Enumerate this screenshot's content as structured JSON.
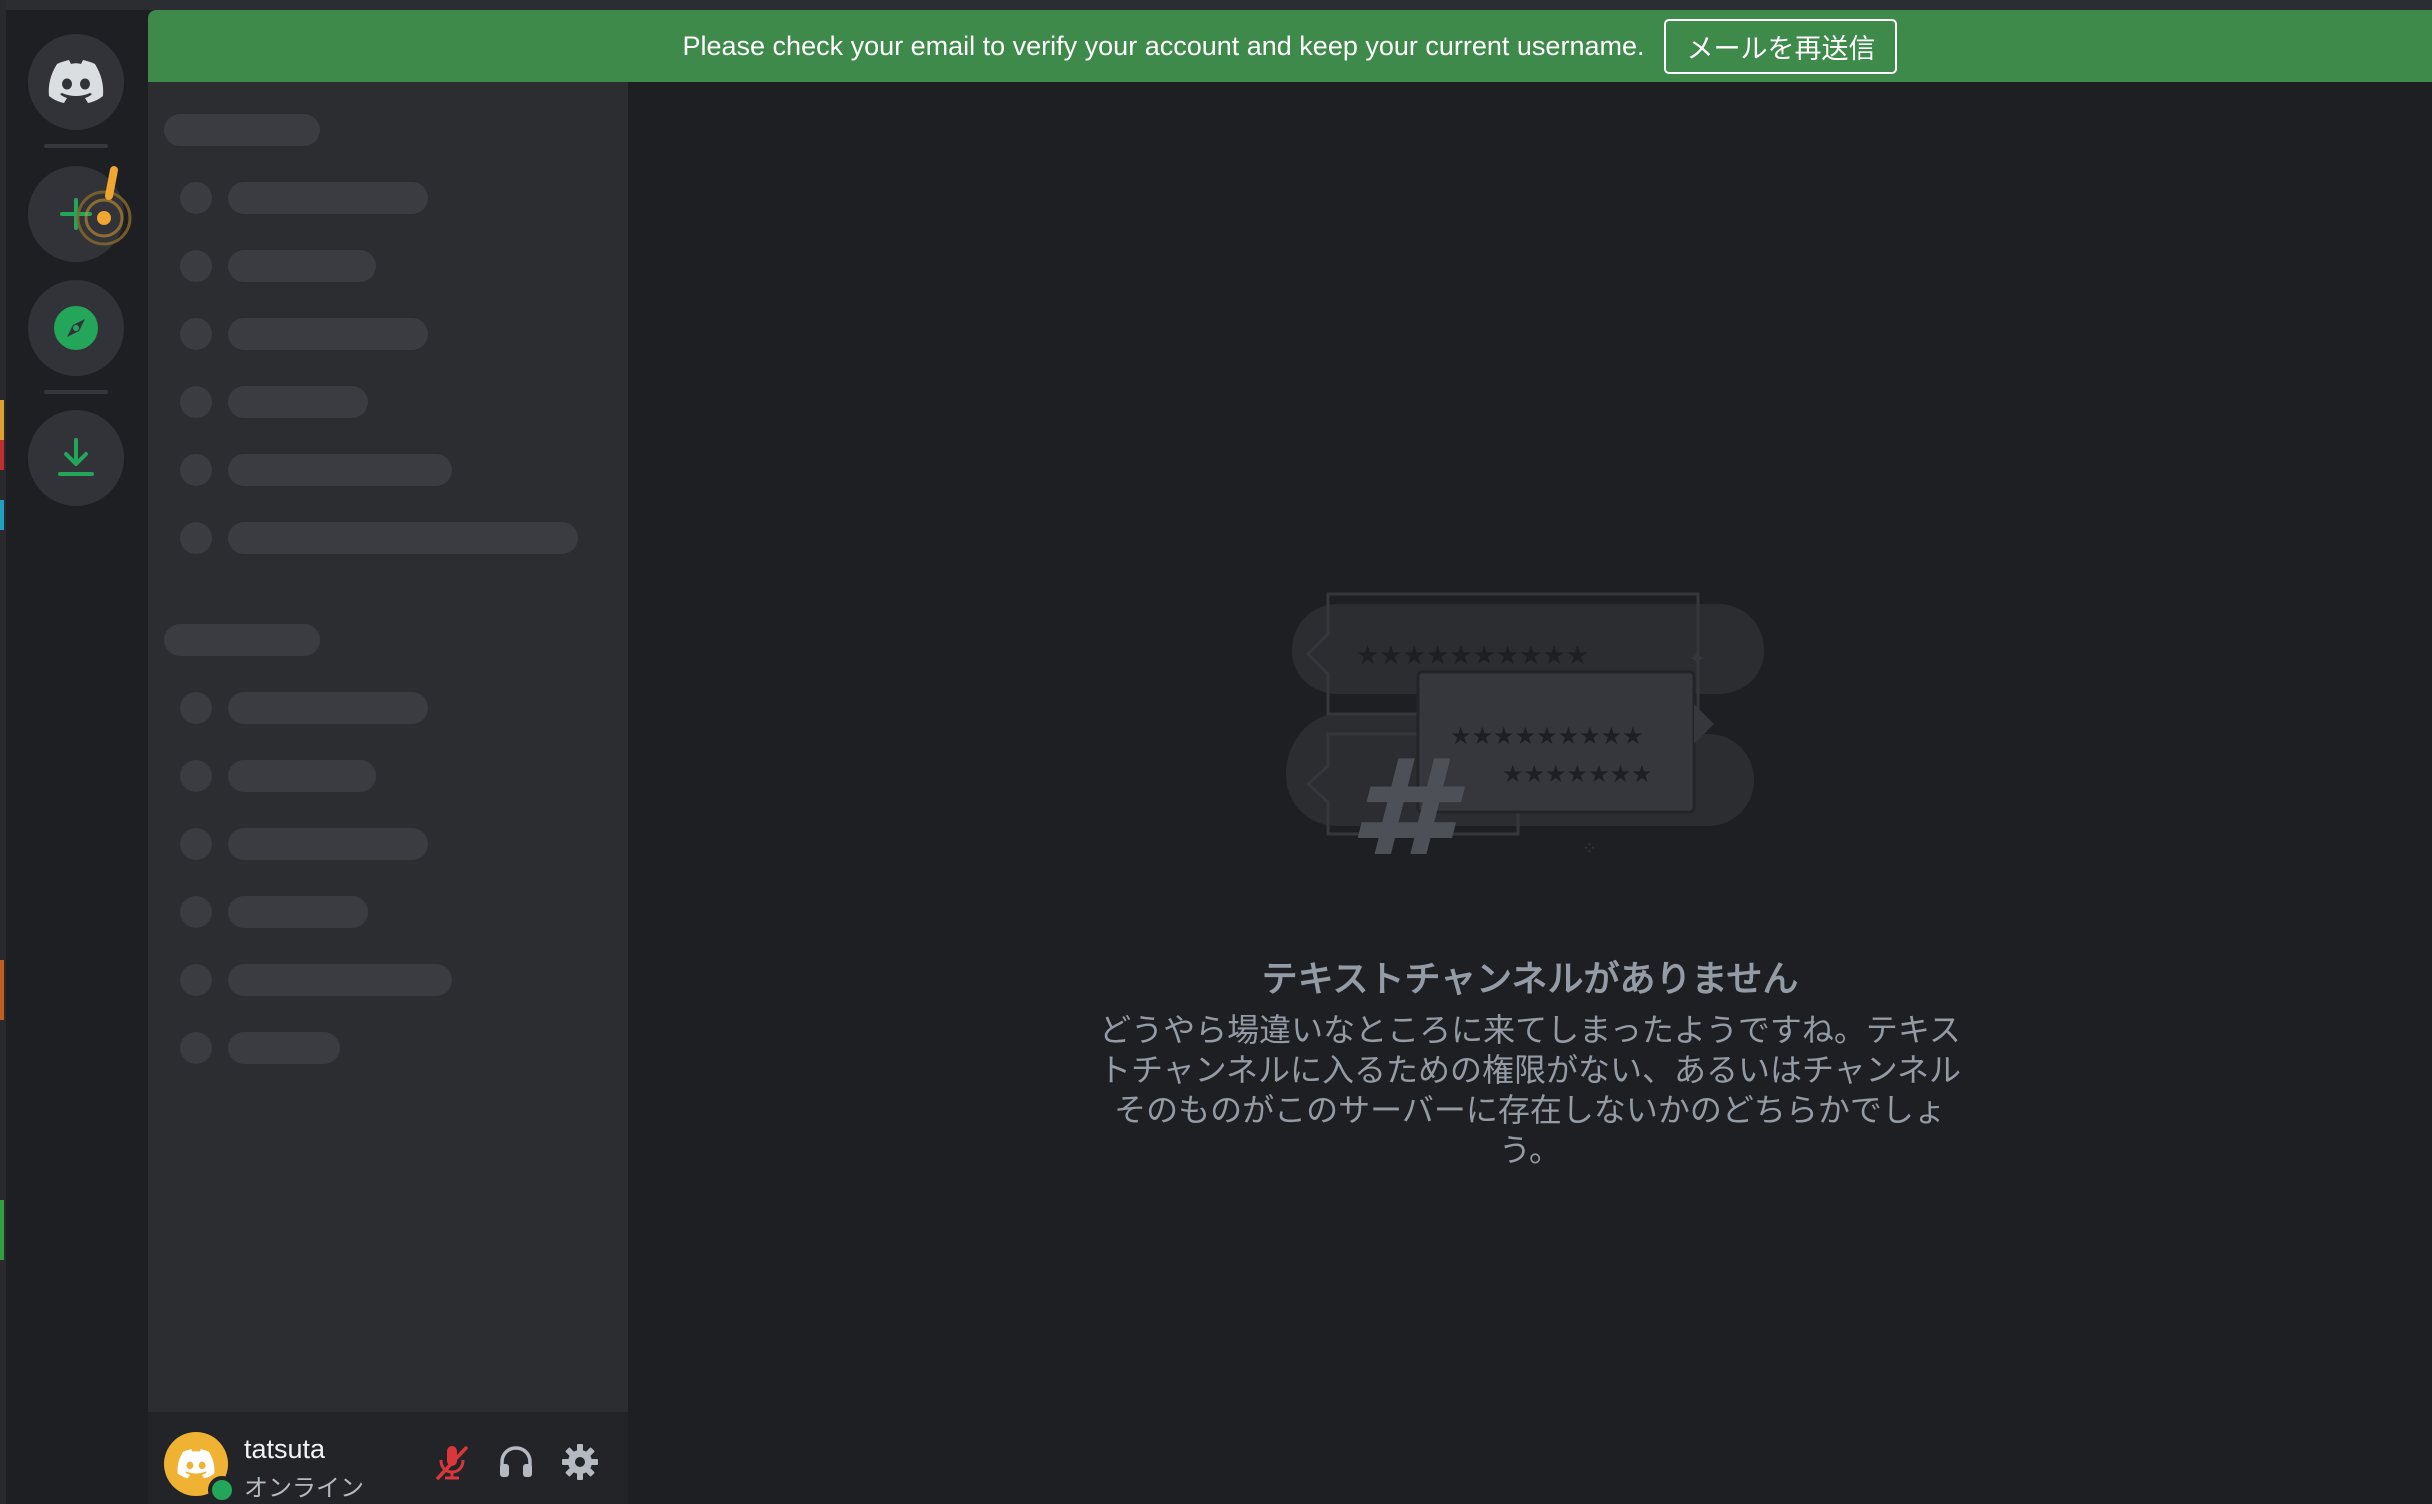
{
  "banner": {
    "message": "Please check your email to verify your account and keep your current username.",
    "button_label": "メールを再送信"
  },
  "rail": {
    "items": [
      {
        "name": "discord-home",
        "icon": "discord-logo-icon"
      },
      {
        "name": "add-server",
        "icon": "plus-icon"
      },
      {
        "name": "explore",
        "icon": "compass-icon"
      },
      {
        "name": "download-apps",
        "icon": "download-icon"
      }
    ]
  },
  "user": {
    "name": "tatsuta",
    "status": "オンライン"
  },
  "empty_state": {
    "title": "テキストチャンネルがありません",
    "description": "どうやら場違いなところに来てしまったようですね。テキストチャンネルに入るための権限がない、あるいはチャンネルそのものがこのサーバーに存在しないかのどちらかでしょう。"
  },
  "colors": {
    "banner": "#3e8a4a",
    "accent_green": "#23a55a",
    "avatar": "#f0b232",
    "mute_red": "#da373c"
  }
}
